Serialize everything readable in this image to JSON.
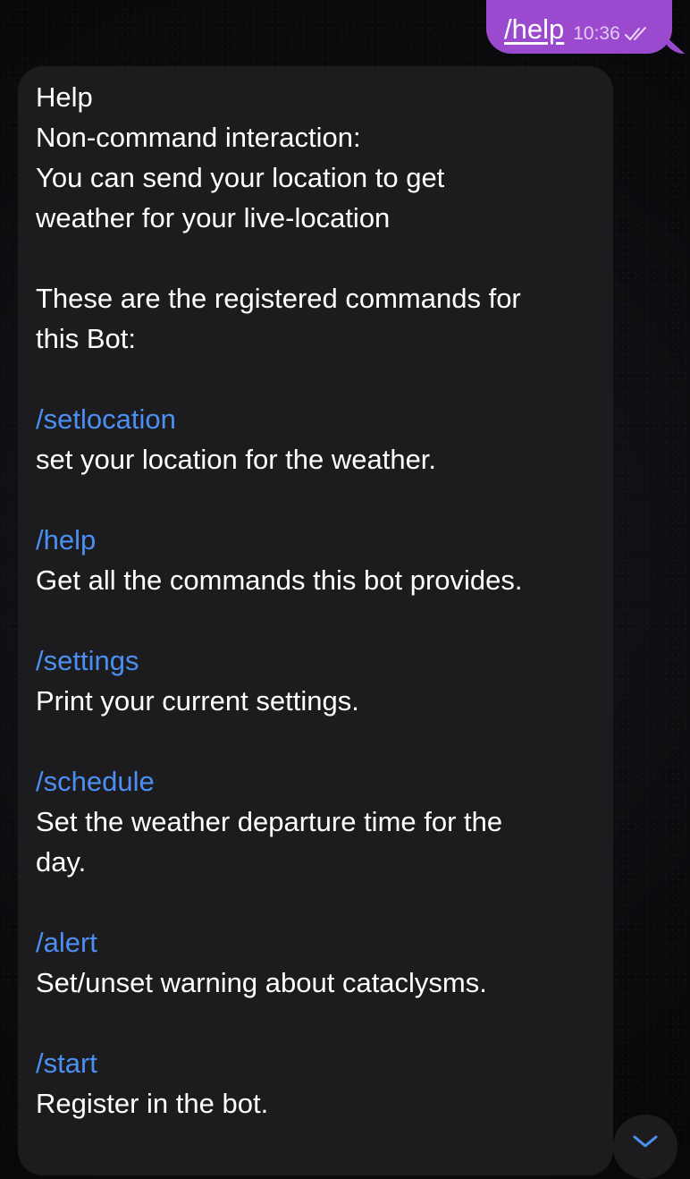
{
  "outgoing": {
    "text": "/help",
    "time": "10:36"
  },
  "incoming": {
    "lines": [
      "Help",
      "Non-command interaction:",
      "You can send your location to get",
      "weather for your live-location",
      "",
      "These are the registered commands for",
      "this Bot:",
      ""
    ],
    "commands": [
      {
        "command": "/setlocation",
        "description": [
          "set your location for the weather."
        ]
      },
      {
        "command": "/help",
        "description": [
          "Get all the commands this bot provides."
        ]
      },
      {
        "command": "/settings",
        "description": [
          "Print your current settings."
        ]
      },
      {
        "command": "/schedule",
        "description": [
          "Set the weather departure time for the",
          "day."
        ]
      },
      {
        "command": "/alert",
        "description": [
          "Set/unset warning about cataclysms."
        ]
      },
      {
        "command": "/start",
        "description": [
          "Register in the bot."
        ]
      }
    ]
  },
  "colors": {
    "outgoing_bubble": "#9b4ad0",
    "incoming_bubble": "#1c1c1e",
    "command_link": "#4c8ff2"
  },
  "icons": {
    "read_receipt": "double-check-icon",
    "scroll_down": "chevron-down-icon"
  }
}
